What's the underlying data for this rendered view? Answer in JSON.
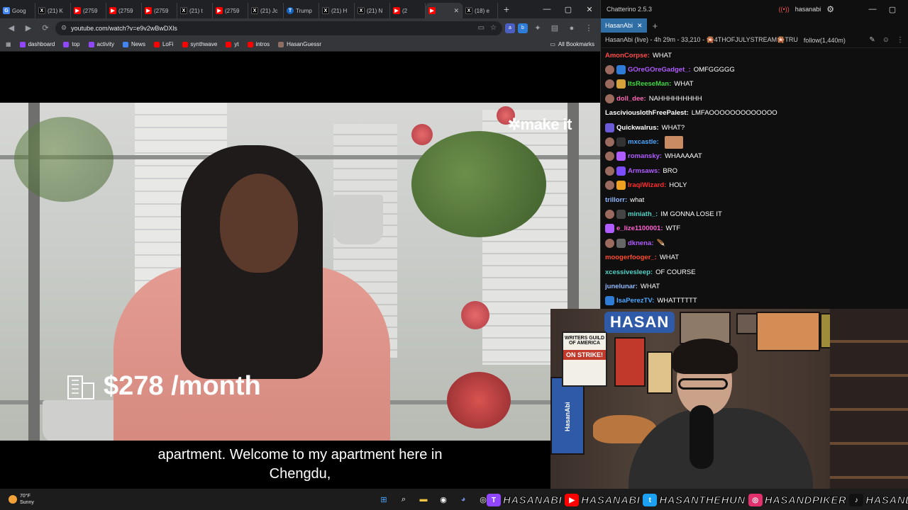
{
  "browser": {
    "tabs": [
      {
        "icon": "google-icon",
        "label": "Goog",
        "fav": "g"
      },
      {
        "icon": "x-icon",
        "label": "(21) K",
        "fav": "x"
      },
      {
        "icon": "youtube-icon",
        "label": "(2759",
        "fav": "yt"
      },
      {
        "icon": "youtube-icon",
        "label": "(2759",
        "fav": "yt"
      },
      {
        "icon": "youtube-icon",
        "label": "(2759",
        "fav": "yt"
      },
      {
        "icon": "x-icon",
        "label": "(21) t",
        "fav": "x"
      },
      {
        "icon": "youtube-icon",
        "label": "(2759",
        "fav": "yt"
      },
      {
        "icon": "x-icon",
        "label": "(21) Jc",
        "fav": "x"
      },
      {
        "icon": "truth-icon",
        "label": "Trump",
        "fav": "tr"
      },
      {
        "icon": "x-icon",
        "label": "(21) H",
        "fav": "x"
      },
      {
        "icon": "x-icon",
        "label": "(21) N",
        "fav": "x"
      },
      {
        "icon": "youtube-icon",
        "label": "(2",
        "fav": "yt"
      },
      {
        "icon": "youtube-icon",
        "label": "",
        "fav": "yt",
        "active": true
      },
      {
        "icon": "x-icon",
        "label": "(18) e",
        "fav": "x"
      }
    ],
    "url": "youtube.com/watch?v=e9v2wBwDXls",
    "bookmarks": [
      {
        "label": "dashboard",
        "color": "#9146ff"
      },
      {
        "label": "top",
        "color": "#9146ff"
      },
      {
        "label": "activity",
        "color": "#9146ff"
      },
      {
        "label": "News",
        "color": "#4285f4"
      },
      {
        "label": "LoFi",
        "color": "#ff0000"
      },
      {
        "label": "synthwave",
        "color": "#ff0000"
      },
      {
        "label": "yt",
        "color": "#ff0000"
      },
      {
        "label": "intros",
        "color": "#ff0000"
      },
      {
        "label": "HasanGuessr",
        "color": "#8d6e63"
      }
    ],
    "all_bookmarks": "All Bookmarks"
  },
  "video": {
    "brand_logo": "make it",
    "price_overlay": "$278 /month",
    "subtitle_line1": "apartment. Welcome to my apartment here in",
    "subtitle_line2": "Chengdu,"
  },
  "chatterino": {
    "title": "Chatterino 2.5.3",
    "account": "hasanabi",
    "tab": "HasanAbi",
    "stream_info": "HasanAbi (live) - 4h 29m - 33,210 - 🎇4THOFJULYSTREAM🎇TRU",
    "follow": "follow(1,440m)",
    "messages": [
      {
        "user": "AmonCorpse:",
        "text": "WHAT",
        "color": "#ff4b4b",
        "badges": []
      },
      {
        "user": "GOreGOreGadget_:",
        "text": "OMFGGGGG",
        "color": "#b05cff",
        "badges": [
          "#9a6b5e",
          "#2f7cd6"
        ]
      },
      {
        "user": "ItsReeseMan:",
        "text": "WHAT",
        "color": "#3dd43d",
        "badges": [
          "#9a6b5e",
          "#d4a13a"
        ]
      },
      {
        "user": "doll_dee:",
        "text": "NAHHHHHHHHH",
        "color": "#ff69b4",
        "badges": [
          "#9a6b5e"
        ]
      },
      {
        "user": "LasciviousIothFreePalest:",
        "text": "LMFAOOOOOOOOOOOOO",
        "color": "#ffffff",
        "badges": []
      },
      {
        "user": "Quickwalrus:",
        "text": "WHAT?",
        "color": "#ffffff",
        "badges": [
          "#6b5bd6"
        ]
      },
      {
        "user": "mxcastle:",
        "text": "",
        "color": "#4aa8ff",
        "badges": [
          "#9a6b5e",
          "#333333"
        ],
        "emote": true
      },
      {
        "user": "romansky:",
        "text": "WHAAAAAT",
        "color": "#b05cff",
        "badges": [
          "#9a6b5e",
          "#b05cff"
        ]
      },
      {
        "user": "Armsaws:",
        "text": "BRO",
        "color": "#b05cff",
        "badges": [
          "#9a6b5e",
          "#7c4dff"
        ]
      },
      {
        "user": "IraqiWizard:",
        "text": "HOLY",
        "color": "#ff2b2b",
        "badges": [
          "#9a6b5e",
          "#f0a020"
        ]
      },
      {
        "user": "trillorr:",
        "text": "what",
        "color": "#8fb8ff",
        "badges": []
      },
      {
        "user": "miniath_:",
        "text": "IM GONNA LOSE IT",
        "color": "#4fd1c5",
        "badges": [
          "#9a6b5e",
          "#444444"
        ]
      },
      {
        "user": "e_lize1100001:",
        "text": "WTF",
        "color": "#ff5fd1",
        "badges": [
          "#b05cff"
        ]
      },
      {
        "user": "dknena:",
        "text": "🪶",
        "color": "#b05cff",
        "badges": [
          "#9a6b5e",
          "#666666"
        ]
      },
      {
        "user": "moogerfooger_:",
        "text": "WHAT",
        "color": "#ff4b2b",
        "badges": []
      },
      {
        "user": "xcessivesleep:",
        "text": "OF COURSE",
        "color": "#4fd1c5",
        "badges": []
      },
      {
        "user": "junelunar:",
        "text": "WHAT",
        "color": "#8fb8ff",
        "badges": []
      },
      {
        "user": "IsaPerezTV:",
        "text": "WHATTTTTT",
        "color": "#4aa8ff",
        "badges": [
          "#2f7cd6"
        ]
      }
    ]
  },
  "webcam": {
    "logo": "HASAN",
    "sign_top": "WRITERS GUILD OF AMERICA",
    "sign_bottom": "ON STRIKE!",
    "banner": "HasanAbi"
  },
  "taskbar": {
    "temperature": "70°F",
    "condition": "Sunny"
  },
  "socials": [
    {
      "icon": "twitch-icon",
      "label": "HASANABI",
      "color": "#9146ff"
    },
    {
      "icon": "youtube-icon",
      "label": "HASANABI",
      "color": "#ff0000"
    },
    {
      "icon": "twitter-icon",
      "label": "HASANTHEHUN",
      "color": "#1da1f2"
    },
    {
      "icon": "instagram-icon",
      "label": "HASANDPIKER",
      "color": "#e1306c"
    },
    {
      "icon": "tiktok-icon",
      "label": "HASANDPIKER",
      "color": "#111111"
    }
  ]
}
